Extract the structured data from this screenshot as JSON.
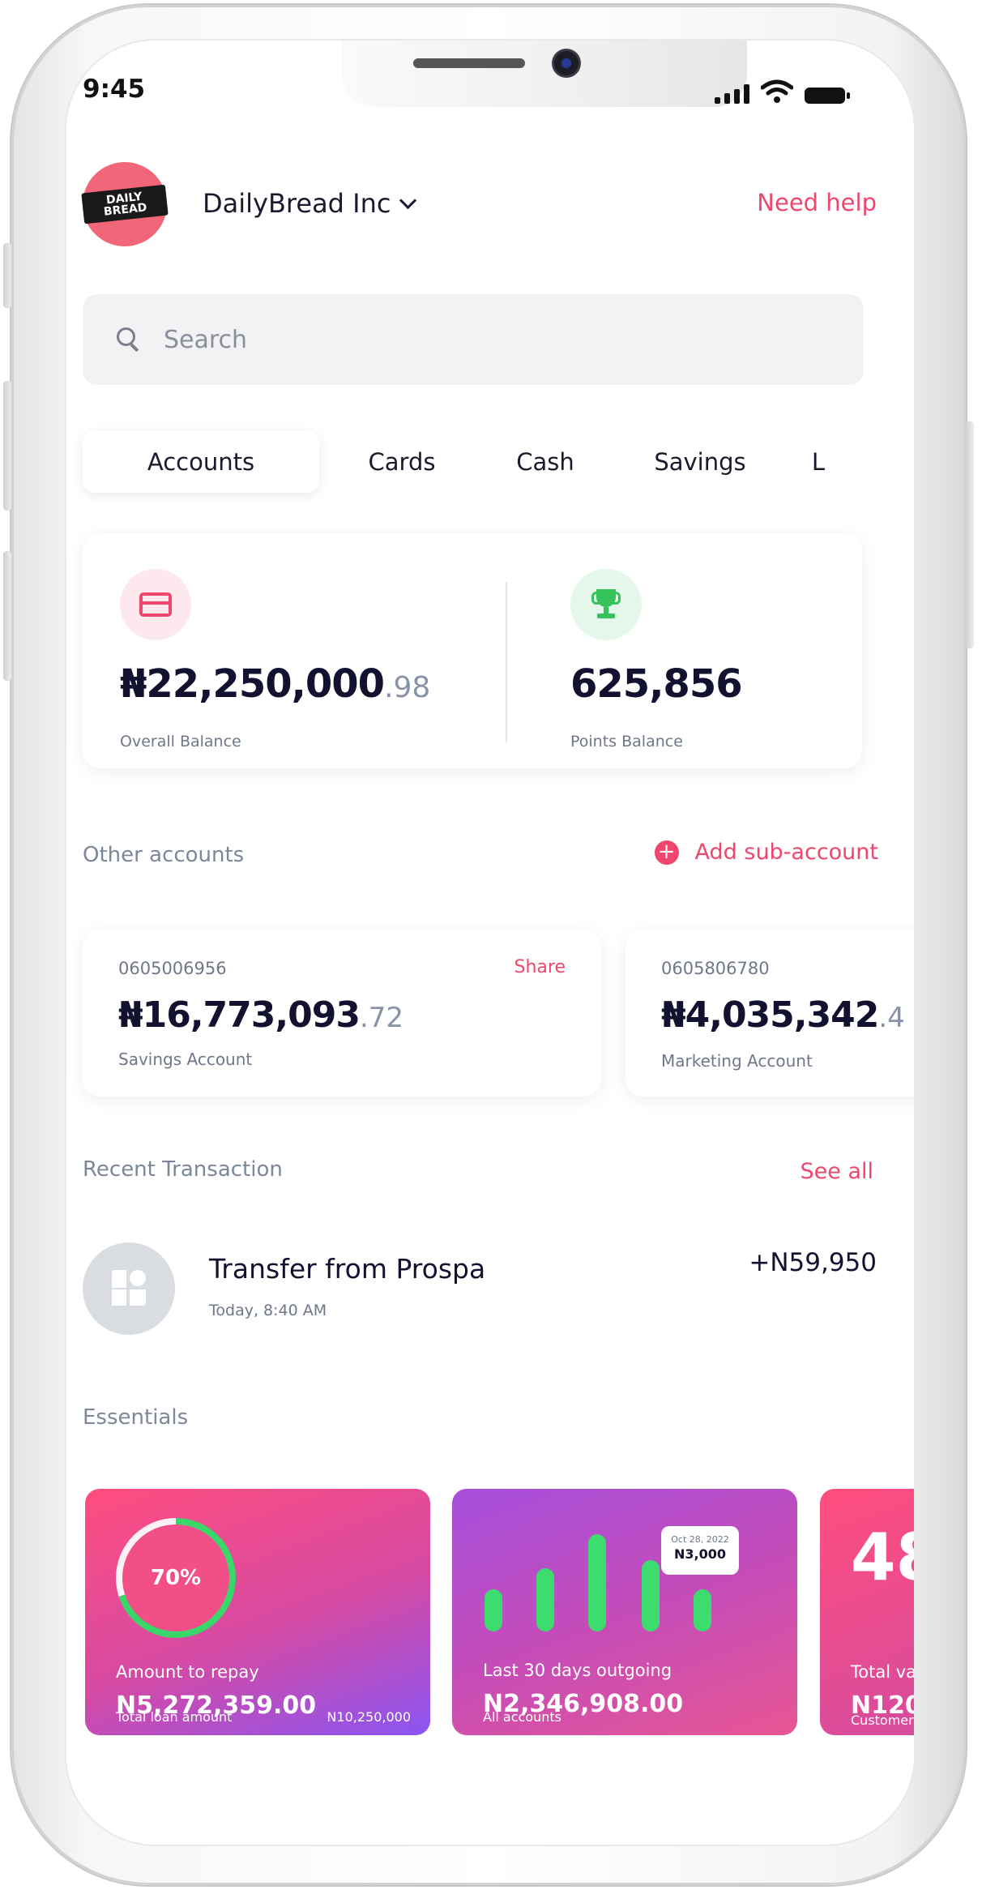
{
  "status_bar": {
    "time": "9:45"
  },
  "header": {
    "logo_text": "DAILY BREAD",
    "org_name": "DailyBread Inc",
    "need_help": "Need help"
  },
  "search": {
    "placeholder": "Search",
    "value": ""
  },
  "tabs": [
    {
      "label": "Accounts",
      "active": true
    },
    {
      "label": "Cards"
    },
    {
      "label": "Cash"
    },
    {
      "label": "Savings"
    },
    {
      "label": "L"
    }
  ],
  "overview": {
    "overall_whole": "₦22,250,000",
    "overall_dec": ".98",
    "overall_label": "Overall Balance",
    "points": "625,856",
    "points_label": "Points Balance"
  },
  "other_accounts": {
    "title": "Other accounts",
    "add_label": "Add sub-account",
    "accounts": [
      {
        "number": "0605006956",
        "share": "Share",
        "amount_whole": "₦16,773,093",
        "amount_dec": ".72",
        "type": "Savings Account"
      },
      {
        "number": "0605806780",
        "amount_whole": "₦4,035,342",
        "amount_dec": ".4",
        "type": "Marketing Account"
      }
    ]
  },
  "recent": {
    "title": "Recent Transaction",
    "see_all": "See all",
    "transaction": {
      "title": "Transfer from Prospa",
      "time": "Today, 8:40 AM",
      "amount": "+N59,950"
    }
  },
  "essentials": {
    "title": "Essentials",
    "loan": {
      "progress_percent": 70,
      "progress_label": "70%",
      "label": "Amount to repay",
      "amount": "N5,272,359.00",
      "total_label": "Total loan amount",
      "total_value": "N10,250,000"
    },
    "outgoing": {
      "tooltip_date": "Oct 28, 2022",
      "tooltip_value": "N3,000",
      "label": "Last 30 days outgoing",
      "amount": "N2,346,908.00",
      "sub": "All accounts"
    },
    "third": {
      "big": "48",
      "label": "Total va",
      "amount": "N120,",
      "sub": "Customers"
    }
  },
  "colors": {
    "accent": "#f0466e",
    "success": "#35c25a",
    "text": "#121230"
  }
}
